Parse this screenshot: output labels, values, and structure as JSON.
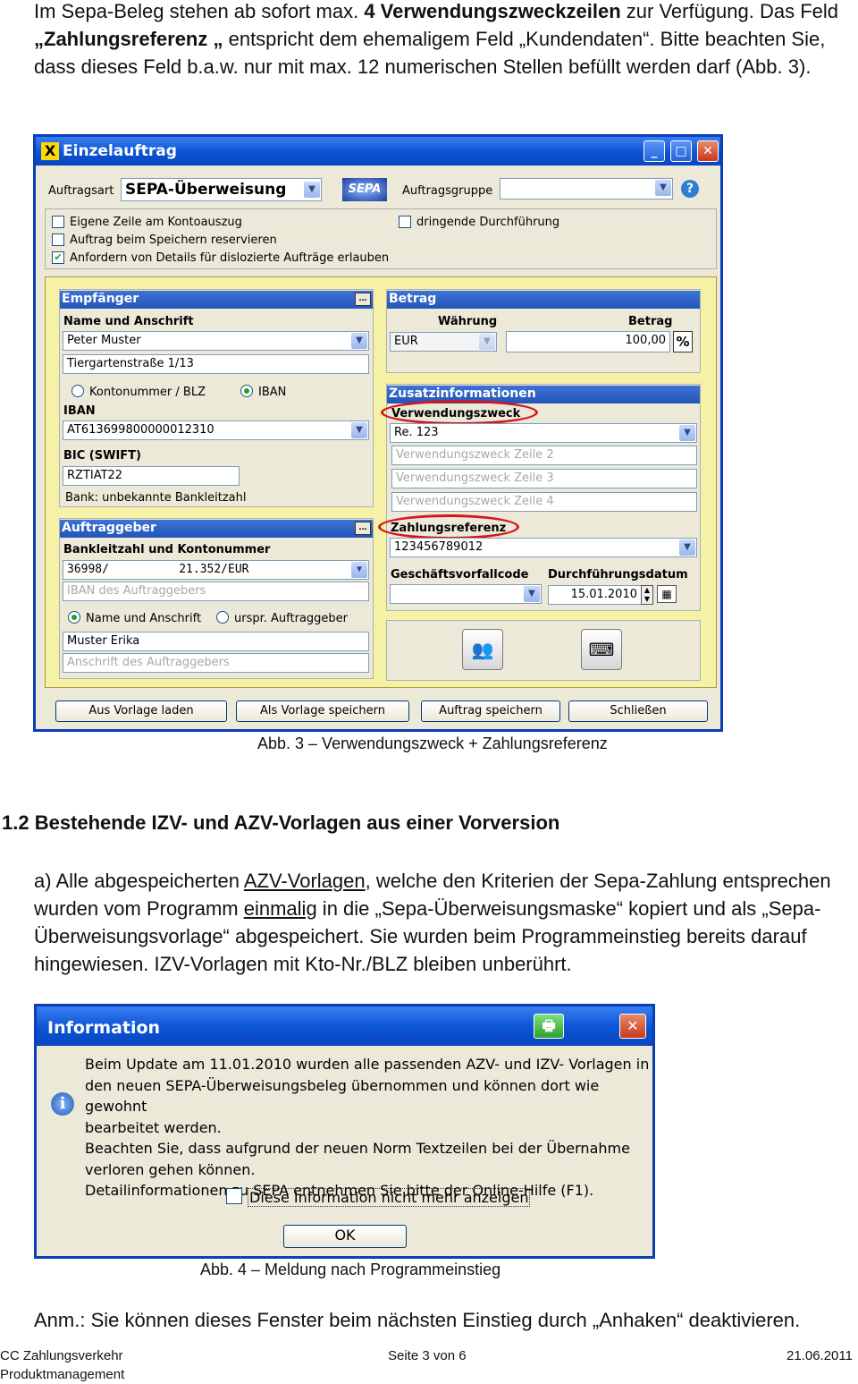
{
  "intro": {
    "t1": "Im Sepa-Beleg stehen ab sofort max. ",
    "b1": "4 Verwendungszweckzeilen",
    "t2": " zur Verfügung. Das Feld ",
    "b2": "„Zahlungsreferenz „",
    "t3": " entspricht dem ehemaligem Feld „Kundendaten“. Bitte beachten Sie, dass dieses Feld b.a.w. nur mit max. 12 numerischen Stellen befüllt werden darf (Abb. 3)."
  },
  "dialog1": {
    "title": "Einzelauftrag",
    "auftragsart_label": "Auftragsart",
    "auftragsart_value": "SEPA-Überweisung",
    "sepa_logo": "SEPA",
    "auftragsgruppe_label": "Auftragsgruppe",
    "auftragsgruppe_value": "",
    "opt_eigene_zeile": "Eigene Zeile am Kontoauszug",
    "opt_reservieren": "Auftrag beim Speichern reservieren",
    "opt_details": "Anfordern von Details für dislozierte Aufträge erlauben",
    "opt_dringend": "dringende Durchführung",
    "empfaenger": {
      "header": "Empfänger",
      "name_label": "Name und Anschrift",
      "name_value": "Peter Muster",
      "address_value": "Tiergartenstraße 1/13",
      "radio_kto": "Kontonummer / BLZ",
      "radio_iban": "IBAN",
      "iban_label": "IBAN",
      "iban_value": "AT613699800000012310",
      "bic_label": "BIC (SWIFT)",
      "bic_value": "RZTIAT22",
      "bank_text": "Bank: unbekannte Bankleitzahl"
    },
    "auftraggeber": {
      "header": "Auftraggeber",
      "blz_label": "Bankleitzahl und Kontonummer",
      "blz_value": "36998/          21.352/EUR",
      "iban_placeholder": "IBAN des Auftraggebers",
      "radio_name": "Name und Anschrift",
      "radio_urspr": "urspr. Auftraggeber",
      "name_value": "Muster Erika",
      "address_placeholder": "Anschrift des Auftraggebers"
    },
    "betrag": {
      "header": "Betrag",
      "waehrung_label": "Währung",
      "waehrung_value": "EUR",
      "betrag_label": "Betrag",
      "betrag_value": "100,00",
      "pct": "%"
    },
    "zusatz": {
      "header": "Zusatzinformationen",
      "verwendungszweck_label": "Verwendungszweck",
      "vz1": "Re. 123",
      "vz2": "Verwendungszweck Zeile 2",
      "vz3": "Verwendungszweck Zeile 3",
      "vz4": "Verwendungszweck Zeile 4",
      "zahlungsreferenz_label": "Zahlungsreferenz",
      "zahlungsreferenz_value": "123456789012",
      "gvc_label": "Geschäftsvorfallcode",
      "gvc_value": "",
      "datum_label": "Durchführungsdatum",
      "datum_value": "15.01.2010"
    },
    "buttons": {
      "vorlage_laden": "Aus Vorlage laden",
      "vorlage_speichern": "Als Vorlage speichern",
      "auftrag_speichern": "Auftrag speichern",
      "schliessen": "Schließen"
    }
  },
  "caption1": "Abb. 3  – Verwendungszweck + Zahlungsreferenz",
  "heading": "1.2  Bestehende IZV- und AZV-Vorlagen aus einer Vorversion",
  "para2": {
    "t1": "a) Alle abgespeicherten ",
    "u1": "AZV-Vorlagen",
    "t2": ", welche den Kriterien der Sepa-Zahlung entsprechen wurden vom Programm ",
    "u2": "einmalig",
    "t3": " in die „Sepa-Überweisungsmaske“ kopiert und als „Sepa-Überweisungsvorlage“ abgespeichert. Sie wurden beim Programmeinstieg bereits darauf hingewiesen. IZV-Vorlagen mit Kto-Nr./BLZ bleiben unberührt."
  },
  "dialog2": {
    "title": "Information",
    "line1": "Beim Update am 11.01.2010 wurden alle passenden AZV- und IZV- Vorlagen in",
    "line2": "den neuen SEPA-Überweisungsbeleg übernommen und können dort wie gewohnt",
    "line3": "bearbeitet werden.",
    "line4": "Beachten Sie, dass aufgrund der neuen Norm Textzeilen bei der Übernahme",
    "line5": "verloren gehen können.",
    "line6": "Detailinformationen zu SEPA entnehmen Sie bitte der Online-Hilfe (F1).",
    "checkbox_label": "Diese Information nicht mehr anzeigen",
    "ok": "OK"
  },
  "caption2": "Abb. 4  – Meldung nach Programmeinstieg",
  "note": "Anm.: Sie können dieses Fenster beim nächsten Einstieg durch „Anhaken“ deaktivieren.",
  "footer": {
    "left1": "CC Zahlungsverkehr",
    "left2": "Produktmanagement",
    "center": "Seite 3 von 6",
    "right": "21.06.2011"
  },
  "colors": {
    "title_blue": "#0b53d6",
    "highlight_red": "#d8141c",
    "panel_yellow": "#f5f1a6"
  }
}
